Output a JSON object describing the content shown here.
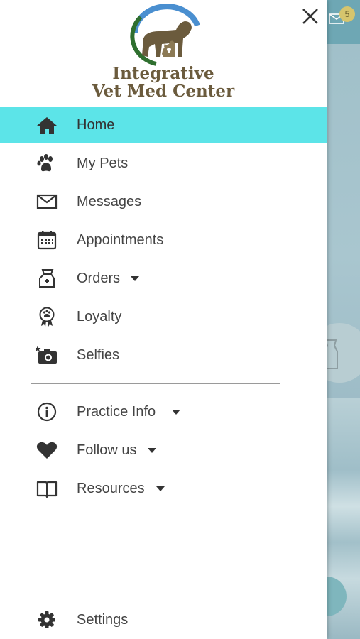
{
  "background": {
    "mail_badge_count": "5"
  },
  "drawer": {
    "logo": {
      "line1": "Integrative",
      "line2": "Vet Med Center"
    },
    "items": [
      {
        "label": "Home",
        "icon": "home-icon",
        "active": true
      },
      {
        "label": "My Pets",
        "icon": "paw-icon"
      },
      {
        "label": "Messages",
        "icon": "envelope-icon"
      },
      {
        "label": "Appointments",
        "icon": "calendar-icon"
      },
      {
        "label": "Orders",
        "icon": "food-bag-icon",
        "dropdown": true
      },
      {
        "label": "Loyalty",
        "icon": "paw-award-icon"
      },
      {
        "label": "Selfies",
        "icon": "camera-icon"
      }
    ],
    "secondary_items": [
      {
        "label": "Practice Info",
        "icon": "info-icon",
        "dropdown": true
      },
      {
        "label": "Follow us",
        "icon": "heart-icon",
        "dropdown": true
      },
      {
        "label": "Resources",
        "icon": "book-icon",
        "dropdown": true
      }
    ],
    "settings": {
      "label": "Settings",
      "icon": "gear-icon"
    }
  },
  "colors": {
    "active_highlight": "#5ce4e8",
    "logo_brown": "#6b5b3d",
    "icon_gray": "#444444"
  }
}
